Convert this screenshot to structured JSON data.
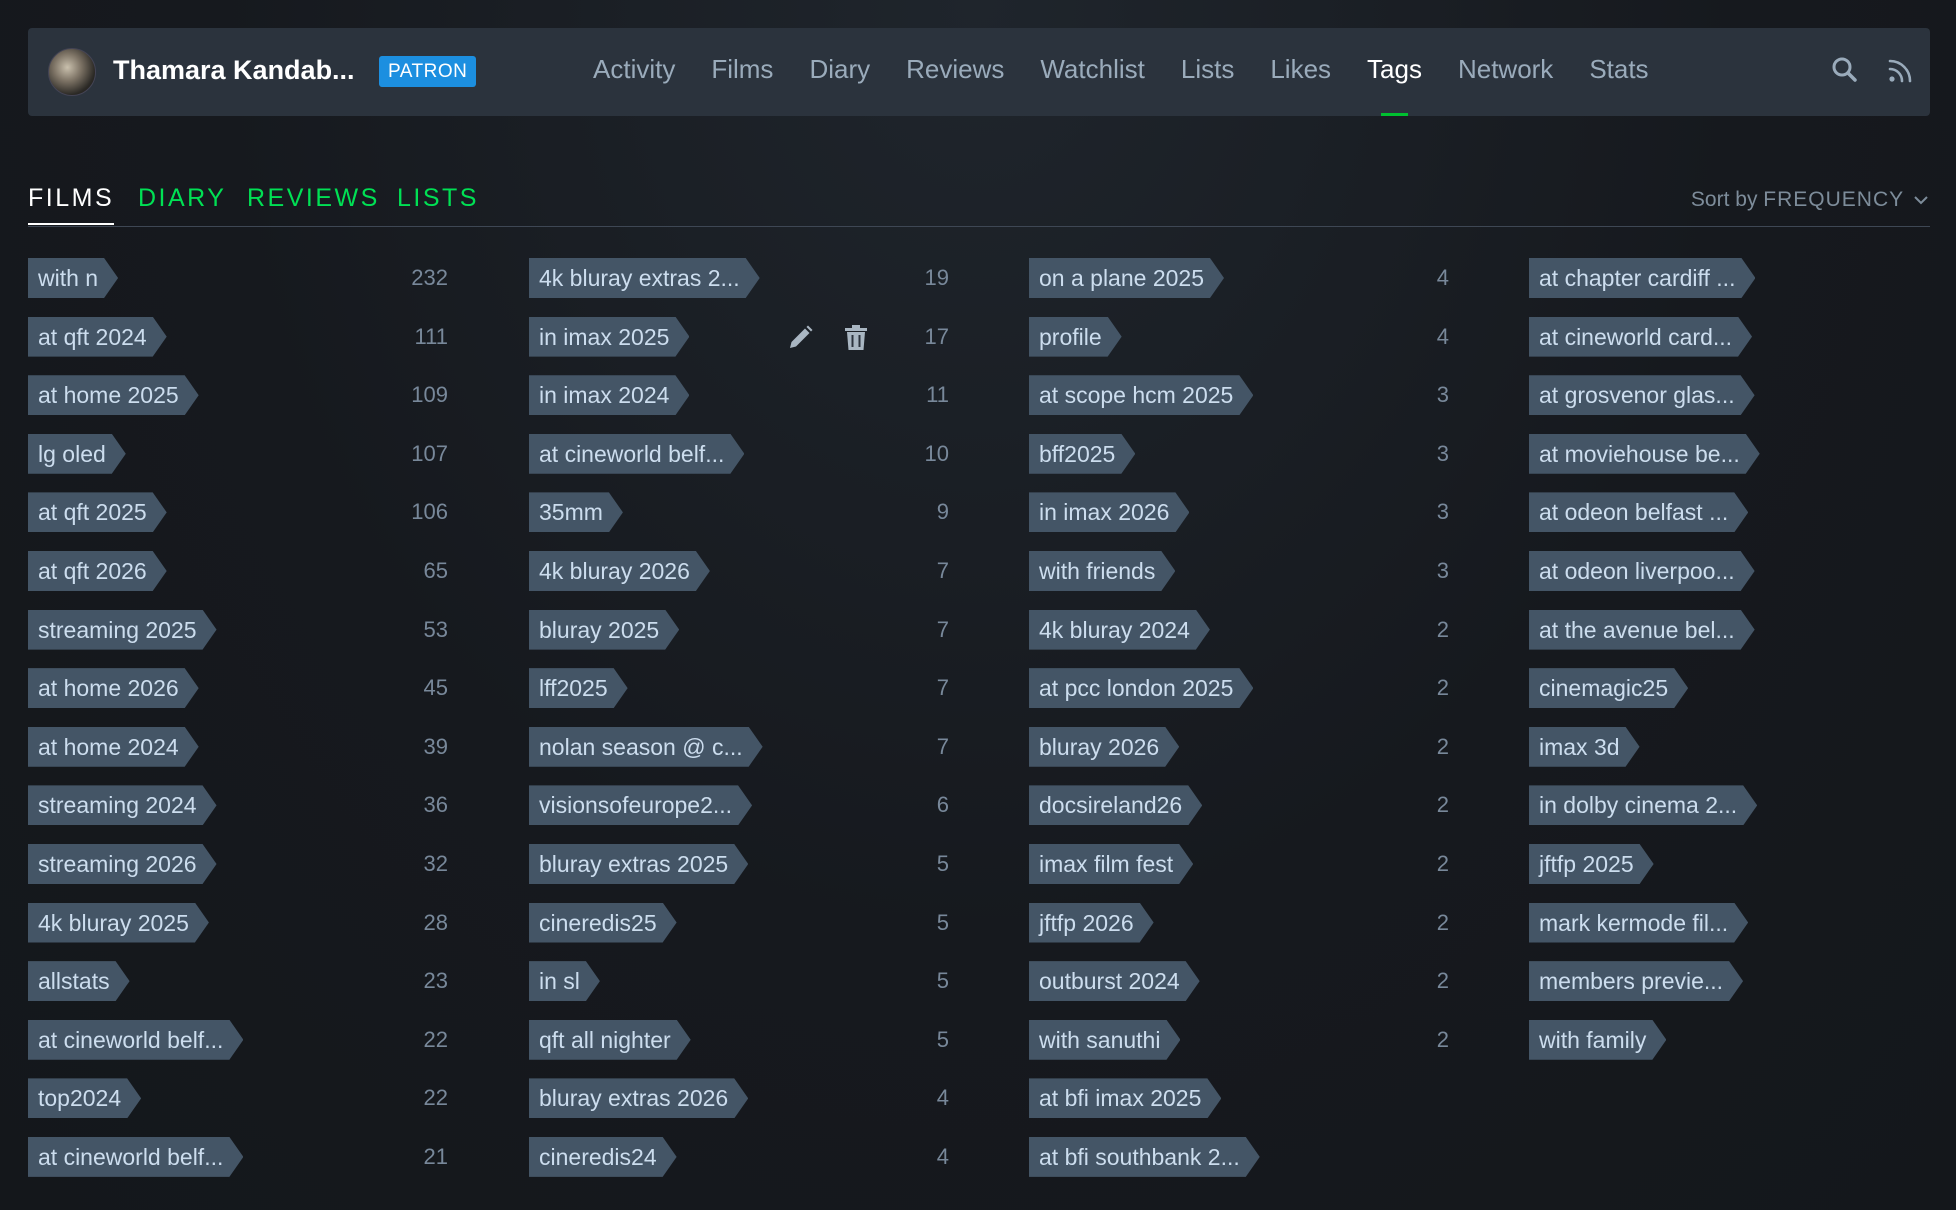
{
  "header": {
    "username": "Thamara Kandab...",
    "badge": "PATRON",
    "nav": [
      {
        "label": "Activity",
        "active": false
      },
      {
        "label": "Films",
        "active": false
      },
      {
        "label": "Diary",
        "active": false
      },
      {
        "label": "Reviews",
        "active": false
      },
      {
        "label": "Watchlist",
        "active": false
      },
      {
        "label": "Lists",
        "active": false
      },
      {
        "label": "Likes",
        "active": false
      },
      {
        "label": "Tags",
        "active": true
      },
      {
        "label": "Network",
        "active": false
      },
      {
        "label": "Stats",
        "active": false
      }
    ],
    "icons": [
      "search-icon",
      "rss-icon"
    ]
  },
  "subtabs": [
    {
      "label": "FILMS",
      "active": true
    },
    {
      "label": "DIARY",
      "active": false
    },
    {
      "label": "REVIEWS",
      "active": false
    },
    {
      "label": "LISTS",
      "active": false
    }
  ],
  "sort": {
    "label": "Sort by",
    "value": "FREQUENCY"
  },
  "colors": {
    "accent": "#00e054",
    "badge": "#1c8fe0",
    "tag_bg": "#445566",
    "underline": "#00c030"
  },
  "tag_columns": [
    [
      {
        "name": "with n",
        "count": "232"
      },
      {
        "name": "at qft 2024",
        "count": "111"
      },
      {
        "name": "at home 2025",
        "count": "109"
      },
      {
        "name": "lg oled",
        "count": "107"
      },
      {
        "name": "at qft 2025",
        "count": "106"
      },
      {
        "name": "at qft 2026",
        "count": "65"
      },
      {
        "name": "streaming 2025",
        "count": "53"
      },
      {
        "name": "at home 2026",
        "count": "45"
      },
      {
        "name": "at home 2024",
        "count": "39"
      },
      {
        "name": "streaming 2024",
        "count": "36"
      },
      {
        "name": "streaming 2026",
        "count": "32"
      },
      {
        "name": "4k bluray 2025",
        "count": "28"
      },
      {
        "name": "allstats",
        "count": "23"
      },
      {
        "name": "at cineworld belf...",
        "count": "22"
      },
      {
        "name": "top2024",
        "count": "22"
      },
      {
        "name": "at cineworld belf...",
        "count": "21"
      }
    ],
    [
      {
        "name": "4k bluray extras 2...",
        "count": "19"
      },
      {
        "name": "in imax 2025",
        "count": "17",
        "show_actions": true
      },
      {
        "name": "in imax 2024",
        "count": "11"
      },
      {
        "name": "at cineworld belf...",
        "count": "10"
      },
      {
        "name": "35mm",
        "count": "9"
      },
      {
        "name": "4k bluray 2026",
        "count": "7"
      },
      {
        "name": "bluray 2025",
        "count": "7"
      },
      {
        "name": "lff2025",
        "count": "7"
      },
      {
        "name": "nolan season @ c...",
        "count": "7"
      },
      {
        "name": "visionsofeurope2...",
        "count": "6"
      },
      {
        "name": "bluray extras 2025",
        "count": "5"
      },
      {
        "name": "cineredis25",
        "count": "5"
      },
      {
        "name": "in sl",
        "count": "5"
      },
      {
        "name": "qft all nighter",
        "count": "5"
      },
      {
        "name": "bluray extras 2026",
        "count": "4"
      },
      {
        "name": "cineredis24",
        "count": "4"
      }
    ],
    [
      {
        "name": "on a plane 2025",
        "count": "4"
      },
      {
        "name": "profile",
        "count": "4"
      },
      {
        "name": "at scope hcm 2025",
        "count": "3"
      },
      {
        "name": "bff2025",
        "count": "3"
      },
      {
        "name": "in imax 2026",
        "count": "3"
      },
      {
        "name": "with friends",
        "count": "3"
      },
      {
        "name": "4k bluray 2024",
        "count": "2"
      },
      {
        "name": "at pcc london 2025",
        "count": "2"
      },
      {
        "name": "bluray 2026",
        "count": "2"
      },
      {
        "name": "docsireland26",
        "count": "2"
      },
      {
        "name": "imax film fest",
        "count": "2"
      },
      {
        "name": "jftfp 2026",
        "count": "2"
      },
      {
        "name": "outburst 2024",
        "count": "2"
      },
      {
        "name": "with sanuthi",
        "count": "2"
      },
      {
        "name": "at bfi imax 2025",
        "count": ""
      },
      {
        "name": "at bfi southbank 2...",
        "count": ""
      }
    ],
    [
      {
        "name": "at chapter cardiff ...",
        "count": ""
      },
      {
        "name": "at cineworld card...",
        "count": ""
      },
      {
        "name": "at grosvenor glas...",
        "count": ""
      },
      {
        "name": "at moviehouse be...",
        "count": ""
      },
      {
        "name": "at odeon belfast ...",
        "count": ""
      },
      {
        "name": "at odeon liverpoo...",
        "count": ""
      },
      {
        "name": "at the avenue bel...",
        "count": ""
      },
      {
        "name": "cinemagic25",
        "count": ""
      },
      {
        "name": "imax 3d",
        "count": ""
      },
      {
        "name": "in dolby cinema 2...",
        "count": ""
      },
      {
        "name": "jftfp 2025",
        "count": ""
      },
      {
        "name": "mark kermode fil...",
        "count": ""
      },
      {
        "name": "members previe...",
        "count": ""
      },
      {
        "name": "with family",
        "count": ""
      }
    ]
  ]
}
